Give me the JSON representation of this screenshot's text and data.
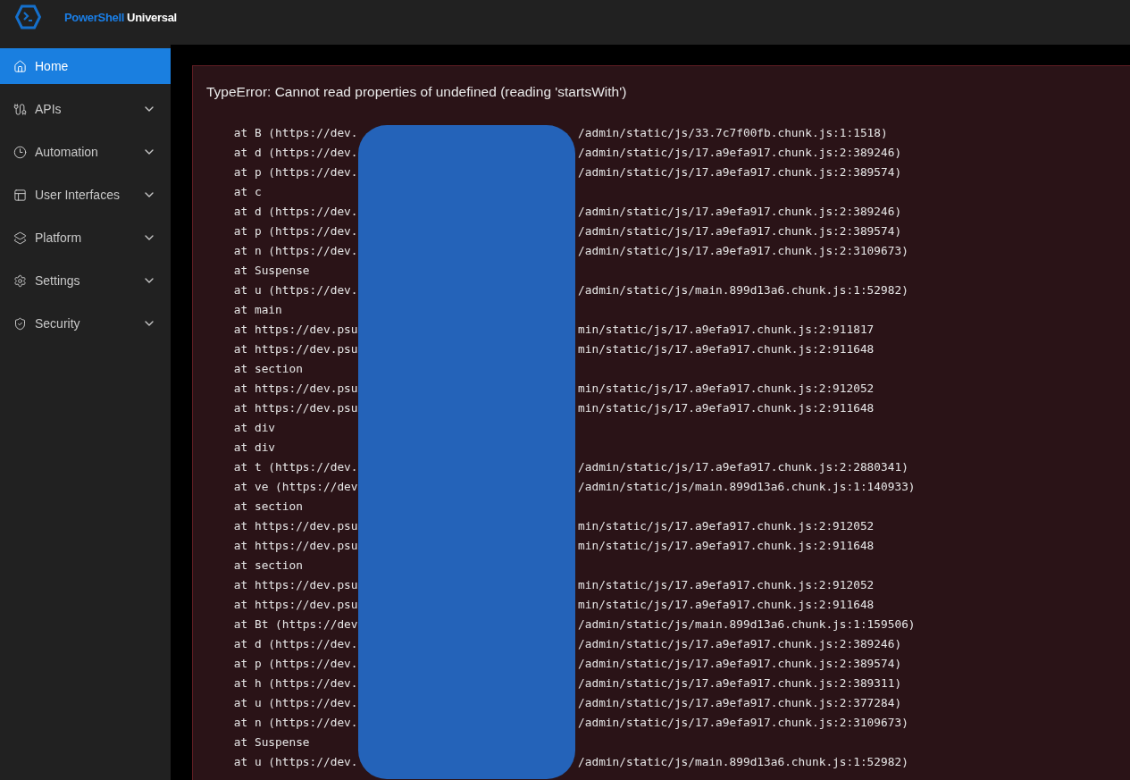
{
  "header": {
    "brand_primary": "PowerShell",
    "brand_secondary": "Universal"
  },
  "sidebar": {
    "items": [
      {
        "label": "Home",
        "selected": true,
        "has_submenu": false
      },
      {
        "label": "APIs",
        "selected": false,
        "has_submenu": true
      },
      {
        "label": "Automation",
        "selected": false,
        "has_submenu": true
      },
      {
        "label": "User Interfaces",
        "selected": false,
        "has_submenu": true
      },
      {
        "label": "Platform",
        "selected": false,
        "has_submenu": true
      },
      {
        "label": "Settings",
        "selected": false,
        "has_submenu": true
      },
      {
        "label": "Security",
        "selected": false,
        "has_submenu": true
      }
    ]
  },
  "error": {
    "message": "TypeError: Cannot read properties of undefined (reading 'startsWith')",
    "stack": [
      {
        "left": "at B (https://dev.",
        "right": "/admin/static/js/33.7c7f00fb.chunk.js:1:1518)"
      },
      {
        "left": "at d (https://dev.",
        "right": "/admin/static/js/17.a9efa917.chunk.js:2:389246)"
      },
      {
        "left": "at p (https://dev.",
        "right": "/admin/static/js/17.a9efa917.chunk.js:2:389574)"
      },
      {
        "left": "at c"
      },
      {
        "left": "at d (https://dev.",
        "right": "/admin/static/js/17.a9efa917.chunk.js:2:389246)"
      },
      {
        "left": "at p (https://dev.",
        "right": "/admin/static/js/17.a9efa917.chunk.js:2:389574)"
      },
      {
        "left": "at n (https://dev.",
        "right": "/admin/static/js/17.a9efa917.chunk.js:2:3109673)"
      },
      {
        "left": "at Suspense"
      },
      {
        "left": "at u (https://dev.",
        "right": "/admin/static/js/main.899d13a6.chunk.js:1:52982)"
      },
      {
        "left": "at main"
      },
      {
        "left": "at https://dev.psu",
        "right": "min/static/js/17.a9efa917.chunk.js:2:911817"
      },
      {
        "left": "at https://dev.psu",
        "right": "min/static/js/17.a9efa917.chunk.js:2:911648"
      },
      {
        "left": "at section"
      },
      {
        "left": "at https://dev.psu",
        "right": "min/static/js/17.a9efa917.chunk.js:2:912052"
      },
      {
        "left": "at https://dev.psu",
        "right": "min/static/js/17.a9efa917.chunk.js:2:911648"
      },
      {
        "left": "at div"
      },
      {
        "left": "at div"
      },
      {
        "left": "at t (https://dev.",
        "right": "/admin/static/js/17.a9efa917.chunk.js:2:2880341)"
      },
      {
        "left": "at ve (https://dev",
        "right": "/admin/static/js/main.899d13a6.chunk.js:1:140933)"
      },
      {
        "left": "at section"
      },
      {
        "left": "at https://dev.psu",
        "right": "min/static/js/17.a9efa917.chunk.js:2:912052"
      },
      {
        "left": "at https://dev.psu",
        "right": "min/static/js/17.a9efa917.chunk.js:2:911648"
      },
      {
        "left": "at section"
      },
      {
        "left": "at https://dev.psu",
        "right": "min/static/js/17.a9efa917.chunk.js:2:912052"
      },
      {
        "left": "at https://dev.psu",
        "right": "min/static/js/17.a9efa917.chunk.js:2:911648"
      },
      {
        "left": "at Bt (https://dev",
        "right": "/admin/static/js/main.899d13a6.chunk.js:1:159506)"
      },
      {
        "left": "at d (https://dev.",
        "right": "/admin/static/js/17.a9efa917.chunk.js:2:389246)"
      },
      {
        "left": "at p (https://dev.",
        "right": "/admin/static/js/17.a9efa917.chunk.js:2:389574)"
      },
      {
        "left": "at h (https://dev.",
        "right": "/admin/static/js/17.a9efa917.chunk.js:2:389311)"
      },
      {
        "left": "at u (https://dev.",
        "right": "/admin/static/js/17.a9efa917.chunk.js:2:377284)"
      },
      {
        "left": "at n (https://dev.",
        "right": "/admin/static/js/17.a9efa917.chunk.js:2:3109673)"
      },
      {
        "left": "at Suspense"
      },
      {
        "left": "at u (https://dev.",
        "right": "/admin/static/js/main.899d13a6.chunk.js:1:52982)"
      }
    ]
  }
}
